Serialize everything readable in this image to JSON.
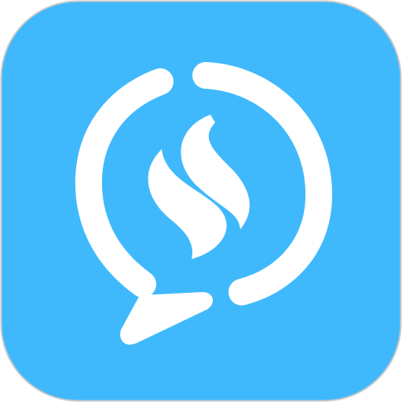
{
  "app_icon": {
    "icon_name": "chat-bubble-s-logo-icon",
    "colors": {
      "background": "#40B9FC",
      "border": "#C8C8C8",
      "glyph": "#FFFFFF"
    }
  }
}
